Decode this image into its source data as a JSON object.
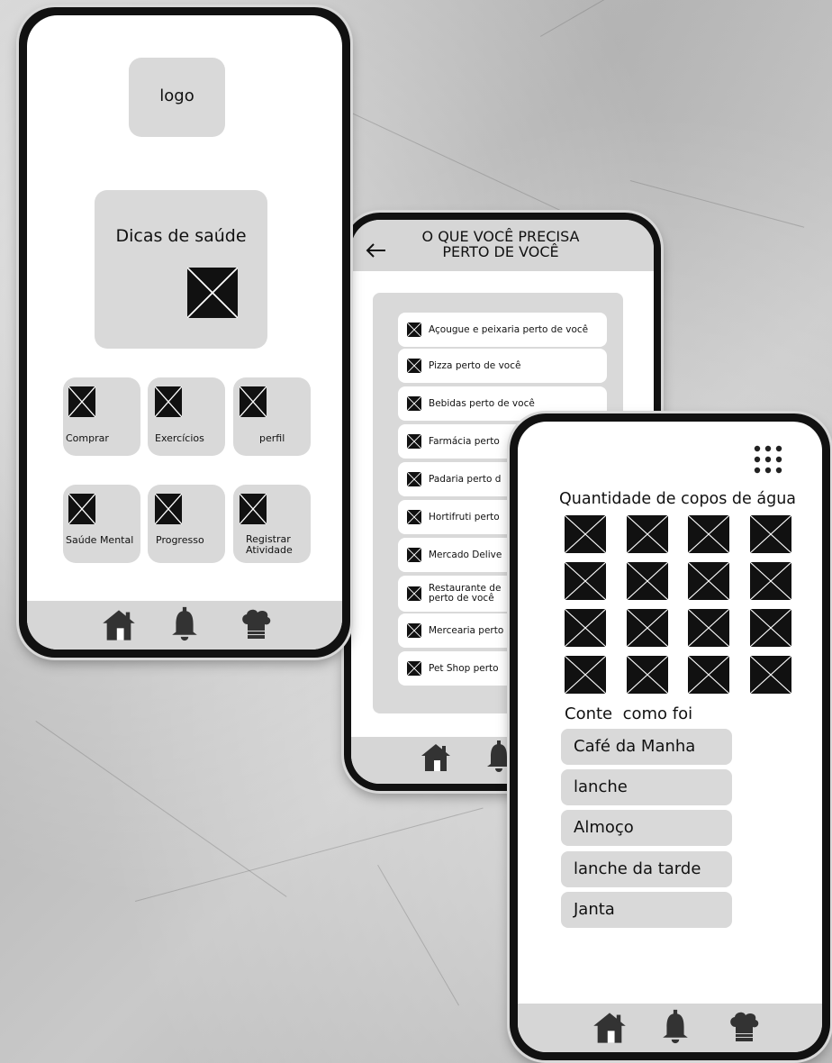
{
  "home_screen": {
    "logo_text": "logo",
    "tips_card": {
      "title": "Dicas de saúde"
    },
    "tiles": [
      {
        "label": "Comprar"
      },
      {
        "label": "Exercícios"
      },
      {
        "label": "perfil"
      },
      {
        "label": "Saúde Mental"
      },
      {
        "label": "Progresso"
      },
      {
        "label": "Registrar Atividade"
      }
    ],
    "nav": [
      "home-icon",
      "bell-icon",
      "chef-hat-icon"
    ]
  },
  "nearby_screen": {
    "back_icon": "arrow-left-icon",
    "title_line1": "O QUE VOCÊ PRECISA",
    "title_line2": "PERTO DE VOCÊ",
    "items": [
      {
        "label": "Açougue e peixaria perto de você"
      },
      {
        "label": "Pizza perto de você"
      },
      {
        "label": "Bebidas perto de você"
      },
      {
        "label": "Farmácia perto"
      },
      {
        "label": "Padaria perto d"
      },
      {
        "label": "Hortifruti perto"
      },
      {
        "label": "Mercado Delive"
      },
      {
        "label": "Restaurante de perto de você"
      },
      {
        "label": "Mercearia perto"
      },
      {
        "label": "Pet Shop perto"
      }
    ],
    "nav": [
      "home-icon",
      "bell-icon"
    ]
  },
  "water_screen": {
    "menu_icon": "grid-dots-icon",
    "water_title": "Quantidade de copos de água",
    "cup_count": 16,
    "meals_title": "Conte  como foi",
    "meals": [
      {
        "label": "Café da Manha"
      },
      {
        "label": "lanche"
      },
      {
        "label": "Almoço"
      },
      {
        "label": "lanche da tarde"
      },
      {
        "label": "Janta"
      }
    ],
    "nav": [
      "home-icon",
      "bell-icon",
      "chef-hat-icon"
    ]
  }
}
